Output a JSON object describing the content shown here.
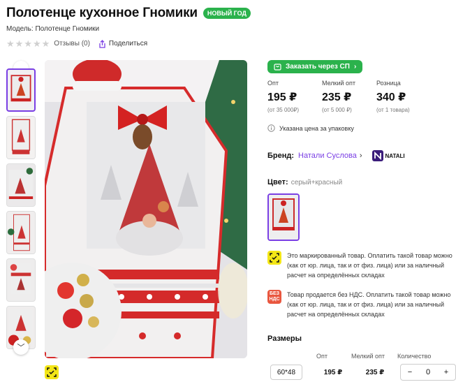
{
  "product": {
    "title": "Полотенце кухонное Гномики",
    "badge": "НОВЫЙ ГОД",
    "model": "Модель: Полотенце Гномики",
    "reviews": "Отзывы (0)",
    "share": "Поделиться",
    "rating": 0
  },
  "order_button": "Заказать через СП",
  "prices": [
    {
      "label": "Опт",
      "value": "195 ₽",
      "note": "(от 35 000₽)"
    },
    {
      "label": "Мелкий опт",
      "value": "235 ₽",
      "note": "(от 5 000 ₽)"
    },
    {
      "label": "Розница",
      "value": "340 ₽",
      "note": "(от 1 товара)"
    }
  ],
  "price_notice": "Указана цена за упаковку",
  "brand": {
    "label": "Бренд:",
    "name": "Натали Суслова",
    "logo_text": "NATALI"
  },
  "color": {
    "label": "Цвет:",
    "value": "серый+красный"
  },
  "info": [
    {
      "icon": "marked-product-icon",
      "text": "Это маркированный товар. Оплатить такой товар можно (как от юр. лица, так и от физ. лица) или за наличный расчет на определённых складах"
    },
    {
      "icon": "no-vat-icon",
      "icon_text": "БЕЗ НДС",
      "text": "Товар продается без НДС. Оплатить такой товар можно (как от юр. лица, так и от физ. лица) или за наличный расчет на определённых складах"
    }
  ],
  "sizes": {
    "title": "Размеры",
    "columns": [
      "Опт",
      "Мелкий опт",
      "Количество"
    ],
    "rows": [
      {
        "size": "60*48",
        "opt": "195 ₽",
        "small_opt": "235 ₽",
        "qty": "0"
      }
    ]
  },
  "colors": {
    "accent": "#7a3fe4",
    "green": "#2bb24c",
    "red": "#d42a2a"
  }
}
